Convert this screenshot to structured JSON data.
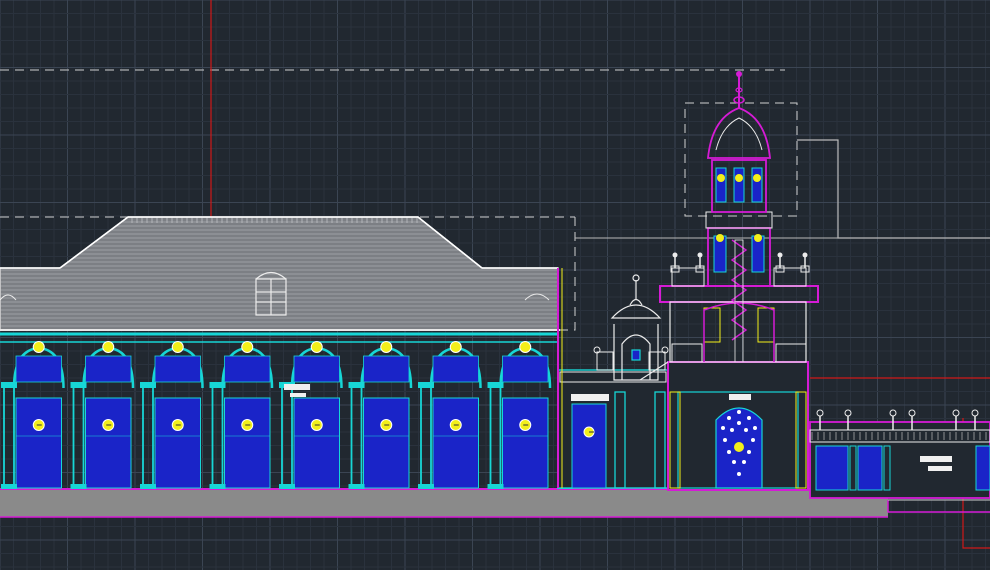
{
  "app": {
    "view_type": "cad-model-space",
    "drawing_kind": "building-elevation"
  },
  "colors": {
    "background": "#212830",
    "grid_major": "#3b4553",
    "grid_minor": "#2a323d",
    "crosshair": "#d01818",
    "roof_fill": "#7c7f84",
    "roof_lines": "#c9ccd0",
    "cyan": "#17d6d6",
    "blue_fill": "#1a24c8",
    "magenta": "#d51bd5",
    "yellow": "#f2ef1a",
    "white": "#e9e9e9",
    "ground": "#8a8a8a"
  },
  "elements": {
    "main_hall": {
      "arches": 8,
      "columns": 9,
      "doors": 8,
      "lamps": 16
    },
    "clock_tower": {
      "levels": 3,
      "finials": 4
    },
    "gate_pavilion": {
      "finials": 2
    },
    "east_wing": {
      "balusters": 6,
      "doors": 3
    }
  }
}
